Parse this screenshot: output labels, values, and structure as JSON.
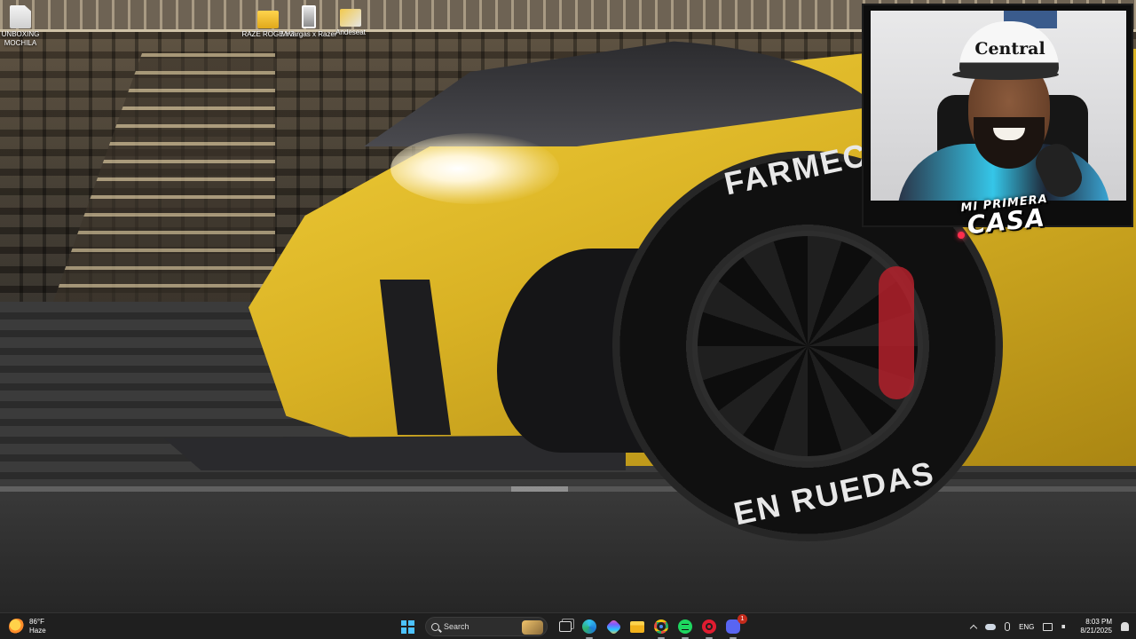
{
  "desktop": {
    "icons": [
      {
        "label": "UNBOXING MOCHILA",
        "type": "file-icon"
      },
      {
        "label": "RAZE ROGE V3",
        "type": "folder-icon"
      },
      {
        "label": "Mrvargas x Razer",
        "type": "photo-icon"
      },
      {
        "label": "Andeseat",
        "type": "app-icon"
      }
    ],
    "wallpaper": {
      "tire_text_top": "FARMEC",
      "tire_text_bottom": "EN RUEDAS"
    }
  },
  "webcam": {
    "cap_text": "Central",
    "caption_line1": "MI PRIMERA",
    "caption_line2": "CASA"
  },
  "taskbar": {
    "weather": {
      "temp": "86°F",
      "condition": "Haze"
    },
    "search": {
      "label": "Search"
    },
    "apps": [
      {
        "name": "task-view-icon"
      },
      {
        "name": "edge-icon"
      },
      {
        "name": "copilot-icon"
      },
      {
        "name": "file-explorer-icon"
      },
      {
        "name": "chrome-icon"
      },
      {
        "name": "spotify-icon"
      },
      {
        "name": "opera-icon"
      },
      {
        "name": "discord-icon",
        "badge": "1"
      }
    ],
    "tray": {
      "language": "ENG",
      "time": "8:03 PM",
      "date": "8/21/2025"
    }
  },
  "colors": {
    "taskbar_bg": "#1f1f1f",
    "start_accent": "#4cc2ff",
    "car_yellow": "#f2cf3a"
  }
}
